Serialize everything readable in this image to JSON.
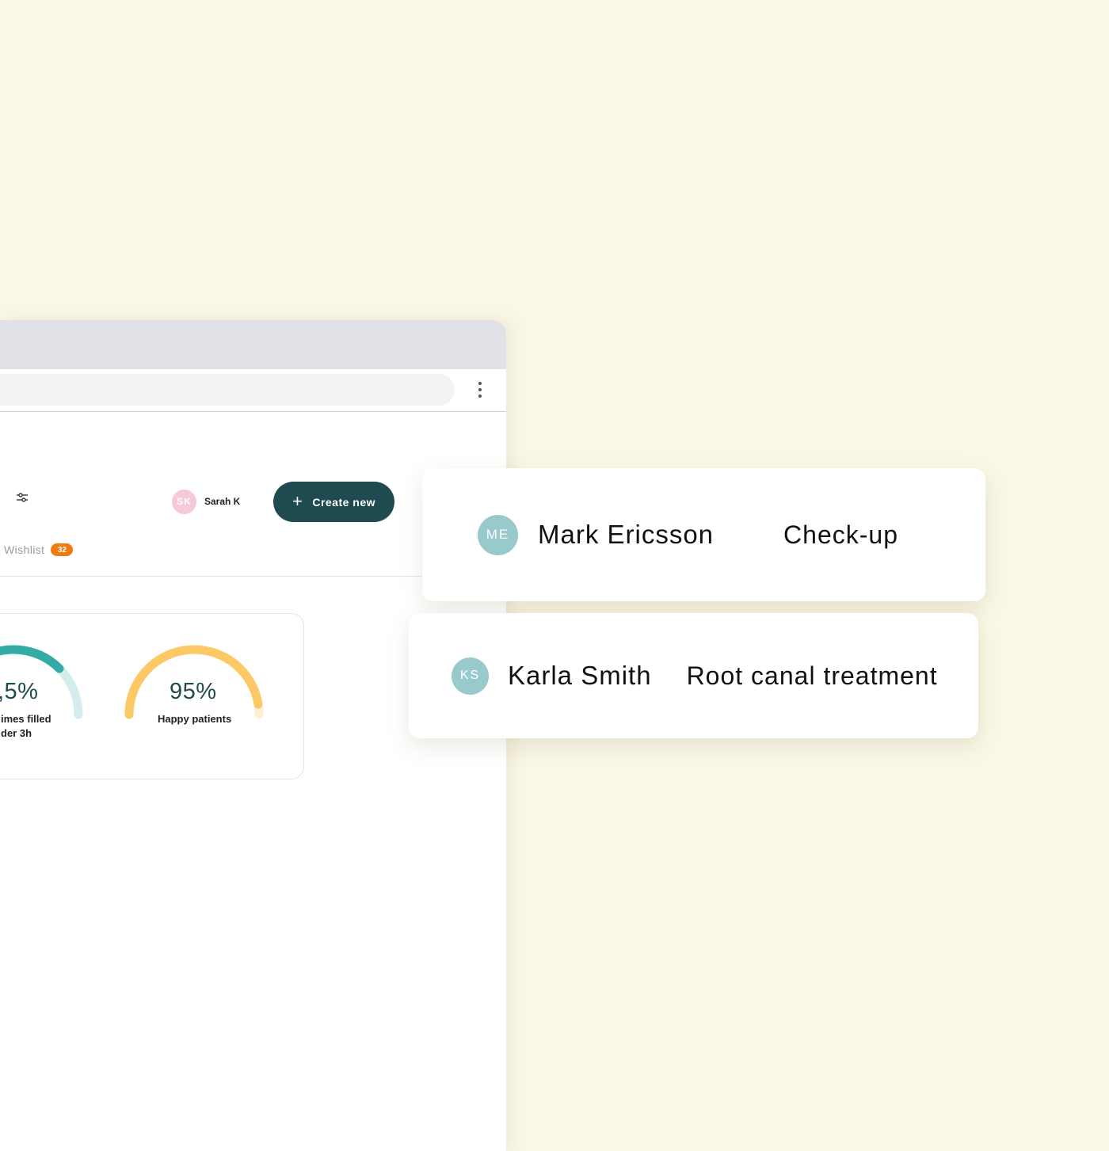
{
  "header": {
    "user": {
      "initials": "SK",
      "name": "Sarah K"
    },
    "create_button": {
      "label": "Create new"
    }
  },
  "tabs": [
    {
      "label": "Wishlist",
      "badge": "32"
    }
  ],
  "stats": [
    {
      "value": ",5%",
      "label_line1": "imes filled",
      "label_line2": "der 3h",
      "color": "#33aca5",
      "track_color": "#d4ecec"
    },
    {
      "value": "95%",
      "label_line1": "Happy patients",
      "label_line2": "",
      "color": "#fdc866",
      "track_color": "#fdf0d4",
      "fill": 0.95
    }
  ],
  "appointments": [
    {
      "initials": "ME",
      "name": "Mark Ericsson",
      "treatment": "Check-up"
    },
    {
      "initials": "KS",
      "name": "Karla Smith",
      "treatment": "Root canal treatment"
    }
  ],
  "colors": {
    "background": "#faf7e6",
    "primary": "#1f4a4f",
    "avatar_pink": "#f7c9d6",
    "avatar_teal": "#98c9cb",
    "badge_orange": "#f07b12"
  },
  "icons": [
    "more-vertical-icon",
    "filter-sliders-icon",
    "plus-icon"
  ]
}
